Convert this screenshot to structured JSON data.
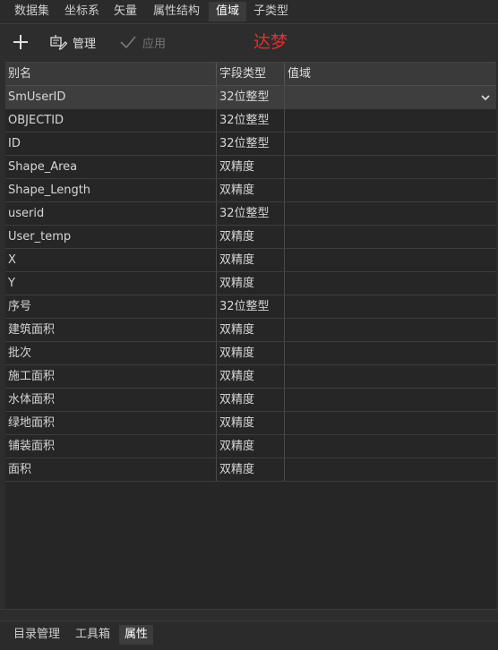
{
  "top_tabs": [
    {
      "label": "数据集",
      "active": false
    },
    {
      "label": "坐标系",
      "active": false
    },
    {
      "label": "矢量",
      "active": false
    },
    {
      "label": "属性结构",
      "active": false
    },
    {
      "label": "值域",
      "active": true
    },
    {
      "label": "子类型",
      "active": false
    }
  ],
  "toolbar": {
    "add_icon": "plus-icon",
    "manage_label": "管理",
    "manage_icon": "manage-edit-icon",
    "apply_label": "应用",
    "apply_icon": "check-icon",
    "brand_text": "达梦"
  },
  "grid": {
    "columns": [
      "别名",
      "字段类型",
      "值域"
    ],
    "rows": [
      {
        "alias": "SmUserID",
        "type": "32位整型",
        "domain": ""
      },
      {
        "alias": "OBJECTID",
        "type": "32位整型",
        "domain": ""
      },
      {
        "alias": "ID",
        "type": "32位整型",
        "domain": ""
      },
      {
        "alias": "Shape_Area",
        "type": "双精度",
        "domain": ""
      },
      {
        "alias": "Shape_Length",
        "type": "双精度",
        "domain": ""
      },
      {
        "alias": "userid",
        "type": "32位整型",
        "domain": ""
      },
      {
        "alias": "User_temp",
        "type": "双精度",
        "domain": ""
      },
      {
        "alias": "X",
        "type": "双精度",
        "domain": ""
      },
      {
        "alias": "Y",
        "type": "双精度",
        "domain": ""
      },
      {
        "alias": "序号",
        "type": "32位整型",
        "domain": ""
      },
      {
        "alias": "建筑面积",
        "type": "双精度",
        "domain": ""
      },
      {
        "alias": "批次",
        "type": "双精度",
        "domain": ""
      },
      {
        "alias": "施工面积",
        "type": "双精度",
        "domain": ""
      },
      {
        "alias": "水体面积",
        "type": "双精度",
        "domain": ""
      },
      {
        "alias": "绿地面积",
        "type": "双精度",
        "domain": ""
      },
      {
        "alias": "铺装面积",
        "type": "双精度",
        "domain": ""
      },
      {
        "alias": "面积",
        "type": "双精度",
        "domain": ""
      }
    ]
  },
  "bottom_tabs": [
    {
      "label": "目录管理",
      "active": false
    },
    {
      "label": "工具箱",
      "active": false
    },
    {
      "label": "属性",
      "active": true
    }
  ],
  "colors": {
    "background": "#2d2d2d",
    "brand_text": "#e0312f",
    "active_tab": "#3b3b3b"
  }
}
